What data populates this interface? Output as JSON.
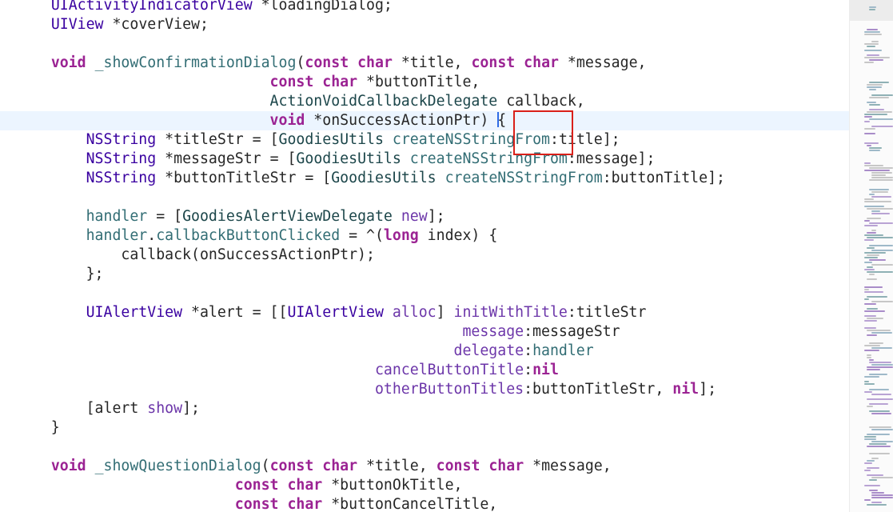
{
  "editor": {
    "language": "Objective-C",
    "current_line_index": 6,
    "cursor_visible": true,
    "lines": [
      {
        "tokens": [
          {
            "t": "    ",
            "c": "plain"
          },
          {
            "t": "UIActivityIndicatorView",
            "c": "typ2"
          },
          {
            "t": " *loadingDialog;",
            "c": "plain"
          }
        ]
      },
      {
        "tokens": [
          {
            "t": "    ",
            "c": "plain"
          },
          {
            "t": "UIView",
            "c": "typ2"
          },
          {
            "t": " *coverView;",
            "c": "plain"
          }
        ]
      },
      {
        "tokens": []
      },
      {
        "tokens": [
          {
            "t": "    ",
            "c": "plain"
          },
          {
            "t": "void",
            "c": "kw"
          },
          {
            "t": " ",
            "c": "plain"
          },
          {
            "t": "_showConfirmationDialog",
            "c": "fn"
          },
          {
            "t": "(",
            "c": "plain"
          },
          {
            "t": "const",
            "c": "kw"
          },
          {
            "t": " ",
            "c": "plain"
          },
          {
            "t": "char",
            "c": "kw"
          },
          {
            "t": " *title, ",
            "c": "plain"
          },
          {
            "t": "const",
            "c": "kw"
          },
          {
            "t": " ",
            "c": "plain"
          },
          {
            "t": "char",
            "c": "kw"
          },
          {
            "t": " *message,",
            "c": "plain"
          }
        ]
      },
      {
        "tokens": [
          {
            "t": "                             ",
            "c": "plain"
          },
          {
            "t": "const",
            "c": "kw"
          },
          {
            "t": " ",
            "c": "plain"
          },
          {
            "t": "char",
            "c": "kw"
          },
          {
            "t": " *buttonTitle,",
            "c": "plain"
          }
        ]
      },
      {
        "tokens": [
          {
            "t": "                             ",
            "c": "plain"
          },
          {
            "t": "ActionVoidCallbackDelegate",
            "c": "proj"
          },
          {
            "t": " callback,",
            "c": "plain"
          }
        ]
      },
      {
        "tokens": [
          {
            "t": "                             ",
            "c": "plain"
          },
          {
            "t": "void",
            "c": "kw"
          },
          {
            "t": " *onSuccessActionPtr) ",
            "c": "plain"
          },
          {
            "t": "|",
            "c": "cursor"
          },
          {
            "t": "{",
            "c": "plain"
          }
        ]
      },
      {
        "tokens": [
          {
            "t": "        ",
            "c": "plain"
          },
          {
            "t": "NSString",
            "c": "typ2"
          },
          {
            "t": " *titleStr = [",
            "c": "plain"
          },
          {
            "t": "GoodiesUtils",
            "c": "proj"
          },
          {
            "t": " ",
            "c": "plain"
          },
          {
            "t": "createNSStringFrom",
            "c": "fn"
          },
          {
            "t": ":title];",
            "c": "plain"
          }
        ]
      },
      {
        "tokens": [
          {
            "t": "        ",
            "c": "plain"
          },
          {
            "t": "NSString",
            "c": "typ2"
          },
          {
            "t": " *messageStr = [",
            "c": "plain"
          },
          {
            "t": "GoodiesUtils",
            "c": "proj"
          },
          {
            "t": " ",
            "c": "plain"
          },
          {
            "t": "createNSStringFrom",
            "c": "fn"
          },
          {
            "t": ":message];",
            "c": "plain"
          }
        ]
      },
      {
        "tokens": [
          {
            "t": "        ",
            "c": "plain"
          },
          {
            "t": "NSString",
            "c": "typ2"
          },
          {
            "t": " *buttonTitleStr = [",
            "c": "plain"
          },
          {
            "t": "GoodiesUtils",
            "c": "proj"
          },
          {
            "t": " ",
            "c": "plain"
          },
          {
            "t": "createNSStringFrom",
            "c": "fn"
          },
          {
            "t": ":buttonTitle];",
            "c": "plain"
          }
        ]
      },
      {
        "tokens": []
      },
      {
        "tokens": [
          {
            "t": "        ",
            "c": "plain"
          },
          {
            "t": "handler",
            "c": "fn"
          },
          {
            "t": " = [",
            "c": "plain"
          },
          {
            "t": "GoodiesAlertViewDelegate",
            "c": "proj"
          },
          {
            "t": " ",
            "c": "plain"
          },
          {
            "t": "new",
            "c": "method"
          },
          {
            "t": "];",
            "c": "plain"
          }
        ]
      },
      {
        "tokens": [
          {
            "t": "        ",
            "c": "plain"
          },
          {
            "t": "handler",
            "c": "fn"
          },
          {
            "t": ".",
            "c": "plain"
          },
          {
            "t": "callbackButtonClicked",
            "c": "fn"
          },
          {
            "t": " = ^(",
            "c": "plain"
          },
          {
            "t": "long",
            "c": "kw"
          },
          {
            "t": " index) {",
            "c": "plain"
          }
        ]
      },
      {
        "tokens": [
          {
            "t": "            callback(onSuccessActionPtr);",
            "c": "plain"
          }
        ]
      },
      {
        "tokens": [
          {
            "t": "        };",
            "c": "plain"
          }
        ]
      },
      {
        "tokens": []
      },
      {
        "tokens": [
          {
            "t": "        ",
            "c": "plain"
          },
          {
            "t": "UIAlertView",
            "c": "typ2"
          },
          {
            "t": " *alert = [[",
            "c": "plain"
          },
          {
            "t": "UIAlertView",
            "c": "typ2"
          },
          {
            "t": " ",
            "c": "plain"
          },
          {
            "t": "alloc",
            "c": "method"
          },
          {
            "t": "] ",
            "c": "plain"
          },
          {
            "t": "initWithTitle",
            "c": "method"
          },
          {
            "t": ":titleStr",
            "c": "plain"
          }
        ]
      },
      {
        "tokens": [
          {
            "t": "                                                   ",
            "c": "plain"
          },
          {
            "t": "message",
            "c": "method"
          },
          {
            "t": ":messageStr",
            "c": "plain"
          }
        ]
      },
      {
        "tokens": [
          {
            "t": "                                                  ",
            "c": "plain"
          },
          {
            "t": "delegate",
            "c": "method"
          },
          {
            "t": ":",
            "c": "plain"
          },
          {
            "t": "handler",
            "c": "fn"
          }
        ]
      },
      {
        "tokens": [
          {
            "t": "                                         ",
            "c": "plain"
          },
          {
            "t": "cancelButtonTitle",
            "c": "method"
          },
          {
            "t": ":",
            "c": "plain"
          },
          {
            "t": "nil",
            "c": "kw"
          }
        ]
      },
      {
        "tokens": [
          {
            "t": "                                         ",
            "c": "plain"
          },
          {
            "t": "otherButtonTitles",
            "c": "method"
          },
          {
            "t": ":buttonTitleStr, ",
            "c": "plain"
          },
          {
            "t": "nil",
            "c": "kw"
          },
          {
            "t": "];",
            "c": "plain"
          }
        ]
      },
      {
        "tokens": [
          {
            "t": "        [alert ",
            "c": "plain"
          },
          {
            "t": "show",
            "c": "method"
          },
          {
            "t": "];",
            "c": "plain"
          }
        ]
      },
      {
        "tokens": [
          {
            "t": "    }",
            "c": "plain"
          }
        ]
      },
      {
        "tokens": []
      },
      {
        "tokens": [
          {
            "t": "    ",
            "c": "plain"
          },
          {
            "t": "void",
            "c": "kw"
          },
          {
            "t": " ",
            "c": "plain"
          },
          {
            "t": "_showQuestionDialog",
            "c": "fn"
          },
          {
            "t": "(",
            "c": "plain"
          },
          {
            "t": "const",
            "c": "kw"
          },
          {
            "t": " ",
            "c": "plain"
          },
          {
            "t": "char",
            "c": "kw"
          },
          {
            "t": " *title, ",
            "c": "plain"
          },
          {
            "t": "const",
            "c": "kw"
          },
          {
            "t": " ",
            "c": "plain"
          },
          {
            "t": "char",
            "c": "kw"
          },
          {
            "t": " *message,",
            "c": "plain"
          }
        ]
      },
      {
        "tokens": [
          {
            "t": "                         ",
            "c": "plain"
          },
          {
            "t": "const",
            "c": "kw"
          },
          {
            "t": " ",
            "c": "plain"
          },
          {
            "t": "char",
            "c": "kw"
          },
          {
            "t": " *buttonOkTitle,",
            "c": "plain"
          }
        ]
      },
      {
        "tokens": [
          {
            "t": "                         ",
            "c": "plain"
          },
          {
            "t": "const",
            "c": "kw"
          },
          {
            "t": " ",
            "c": "plain"
          },
          {
            "t": "char",
            "c": "kw"
          },
          {
            "t": " *buttonCancelTitle,",
            "c": "plain"
          }
        ]
      }
    ]
  },
  "colors": {
    "keyword": "#9b2393",
    "type": "#3900a0",
    "project_type": "#1c464a",
    "function": "#326d74",
    "method": "#6c36a9",
    "plain_text": "#262626",
    "current_line": "#ecf5ff",
    "cursor": "#2f6be6",
    "annotation_box": "#d9201a"
  }
}
